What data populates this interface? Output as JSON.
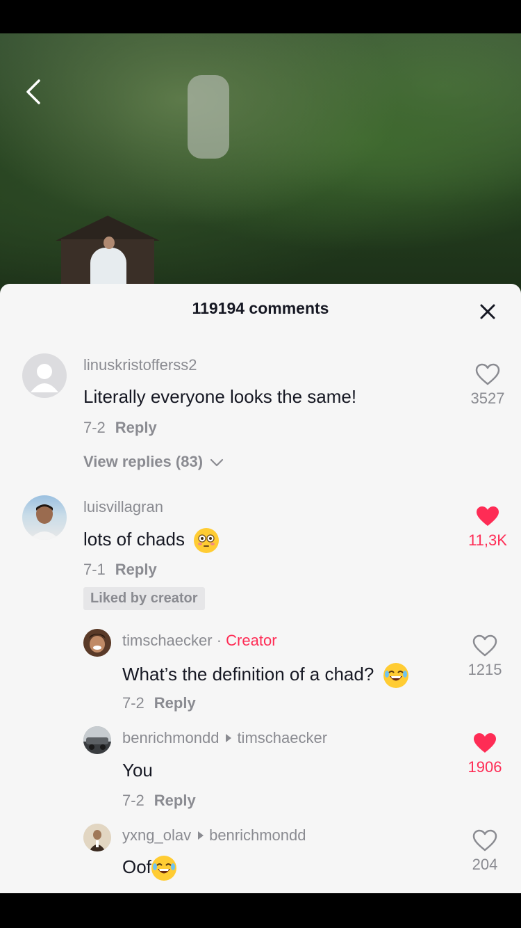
{
  "header": {
    "comment_count_title": "119194 comments"
  },
  "comments": [
    {
      "username": "linuskristofferss2",
      "text": "Literally everyone looks the same!",
      "date": "7-2",
      "reply_label": "Reply",
      "likes": "3527",
      "liked": false,
      "view_replies": "View replies (83)"
    },
    {
      "username": "luisvillagran",
      "text": "lots of chads",
      "date": "7-1",
      "reply_label": "Reply",
      "likes": "11,3K",
      "liked": true,
      "badge": "Liked by creator"
    }
  ],
  "replies": [
    {
      "username": "timschaecker",
      "creator_sep": " · ",
      "creator_label": "Creator",
      "text": "What’s the definition of a chad?",
      "date": "7-2",
      "reply_label": "Reply",
      "likes": "1215",
      "liked": false
    },
    {
      "username": "benrichmondd",
      "reply_to": "timschaecker",
      "text": "You",
      "date": "7-2",
      "reply_label": "Reply",
      "likes": "1906",
      "liked": true
    },
    {
      "username": "yxng_olav",
      "reply_to": "benrichmondd",
      "text": "Oof",
      "likes": "204",
      "liked": false
    }
  ],
  "colors": {
    "accent": "#fe2c55",
    "muted": "#8a8b91",
    "text": "#161823",
    "sheet": "#f6f6f6"
  },
  "icons": [
    "back-icon",
    "close-icon",
    "heart-icon",
    "chevron-down-icon",
    "flushed-emoji-icon",
    "laughing-emoji-icon"
  ]
}
